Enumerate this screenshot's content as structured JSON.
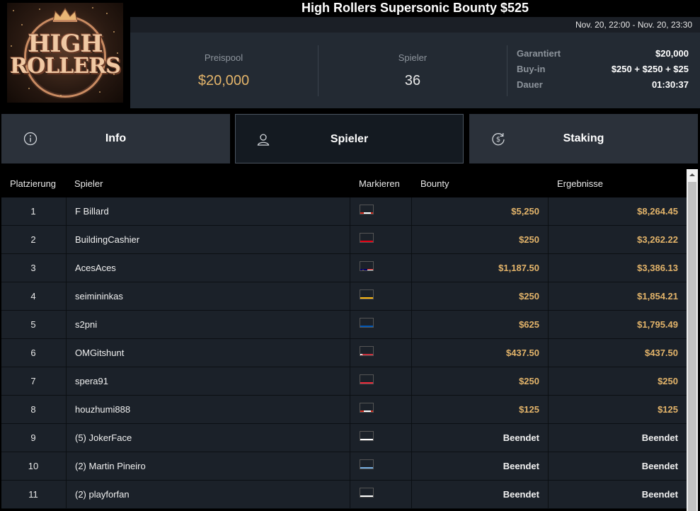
{
  "header": {
    "title": "High Rollers Supersonic Bounty $525",
    "date_range": "Nov. 20, 22:00 - Nov. 20, 23:30",
    "logo_line1": "HIGH",
    "logo_line2": "ROLLERS"
  },
  "stats": {
    "prize_pool_label": "Preispool",
    "prize_pool_value": "$20,000",
    "players_label": "Spieler",
    "players_value": "36"
  },
  "details": [
    {
      "label": "Garantiert",
      "value": "$20,000"
    },
    {
      "label": "Buy-in",
      "value": "$250 + $250 + $25"
    },
    {
      "label": "Dauer",
      "value": "01:30:37"
    }
  ],
  "tabs": {
    "info": "Info",
    "spieler": "Spieler",
    "staking": "Staking"
  },
  "table": {
    "columns": {
      "place": "Platzierung",
      "player": "Spieler",
      "mark": "Markieren",
      "bounty": "Bounty",
      "result": "Ergebnisse"
    },
    "rows": [
      {
        "place": "1",
        "player": "F Billard",
        "flag": "ca",
        "bounty": "$5,250",
        "result": "$8,264.45"
      },
      {
        "place": "2",
        "player": "BuildingCashier",
        "flag": "tn",
        "bounty": "$250",
        "result": "$3,262.22"
      },
      {
        "place": "3",
        "player": "AcesAces",
        "flag": "my",
        "bounty": "$1,187.50",
        "result": "$3,386.13"
      },
      {
        "place": "4",
        "player": "seimininkas",
        "flag": "lt",
        "bounty": "$250",
        "result": "$1,854.21"
      },
      {
        "place": "5",
        "player": "s2pni",
        "flag": "ua",
        "bounty": "$625",
        "result": "$1,795.49"
      },
      {
        "place": "6",
        "player": "OMGitshunt",
        "flag": "by",
        "bounty": "$437.50",
        "result": "$437.50"
      },
      {
        "place": "7",
        "player": "spera91",
        "flag": "at",
        "bounty": "$250",
        "result": "$250"
      },
      {
        "place": "8",
        "player": "houzhumi888",
        "flag": "ca",
        "bounty": "$125",
        "result": "$125"
      },
      {
        "place": "9",
        "player": "(5) JokerFace",
        "flag": "ru",
        "bounty": "Beendet",
        "result": "Beendet"
      },
      {
        "place": "10",
        "player": "(2) Martin Pineiro",
        "flag": "ar",
        "bounty": "Beendet",
        "result": "Beendet"
      },
      {
        "place": "11",
        "player": "(2) playforfan",
        "flag": "ru",
        "bounty": "Beendet",
        "result": "Beendet"
      }
    ]
  },
  "colors": {
    "gold": "#e3b46a",
    "row_bg": "#1b2129",
    "panel_bg": "#232a33"
  }
}
